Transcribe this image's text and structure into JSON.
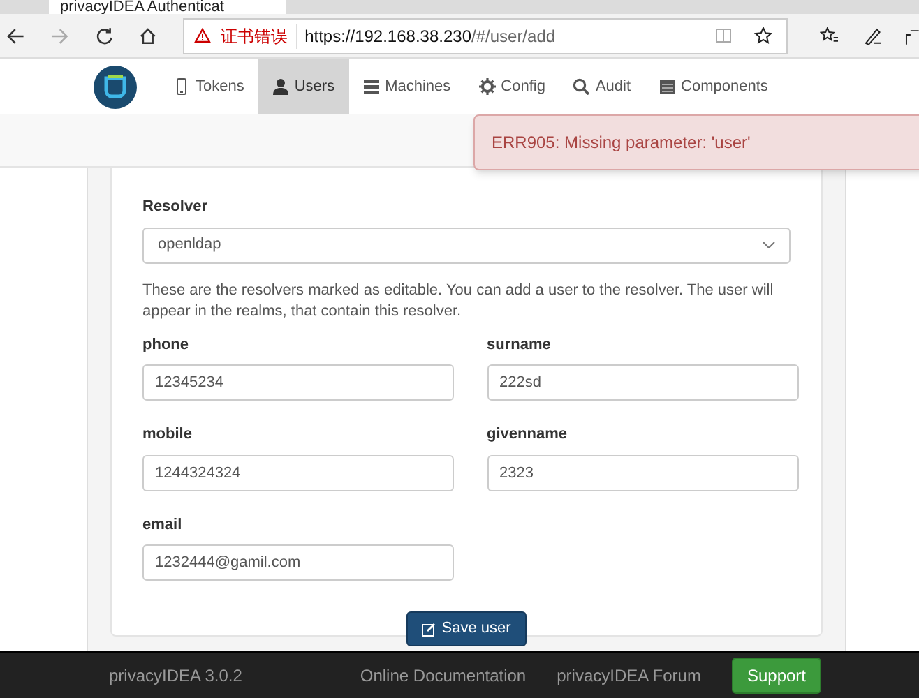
{
  "browser": {
    "tab_title": "privacyIDEA Authenticat",
    "cert_warning": "证书错误",
    "url_host": "https://192.168.38.230",
    "url_path": "/#/user/add"
  },
  "nav": [
    {
      "label": "Tokens",
      "selected": false
    },
    {
      "label": "Users",
      "selected": true
    },
    {
      "label": "Machines",
      "selected": false
    },
    {
      "label": "Config",
      "selected": false
    },
    {
      "label": "Audit",
      "selected": false
    },
    {
      "label": "Components",
      "selected": false
    }
  ],
  "error": {
    "message": "ERR905: Missing parameter: 'user'"
  },
  "form": {
    "resolver_label": "Resolver",
    "resolver_value": "openldap",
    "help": "These are the resolvers marked as editable. You can add a user to the resolver. The user will appear in the realms, that contain this resolver.",
    "fields": [
      {
        "label": "phone",
        "value": "12345234"
      },
      {
        "label": "surname",
        "value": "222sd"
      },
      {
        "label": "mobile",
        "value": "1244324324"
      },
      {
        "label": "givenname",
        "value": "2323"
      },
      {
        "label": "email",
        "value": "1232444@gamil.com"
      }
    ],
    "save": "Save user"
  },
  "footer": {
    "version": "privacyIDEA 3.0.2",
    "links": [
      "Online Documentation",
      "privacyIDEA Forum"
    ],
    "support": "Support"
  }
}
